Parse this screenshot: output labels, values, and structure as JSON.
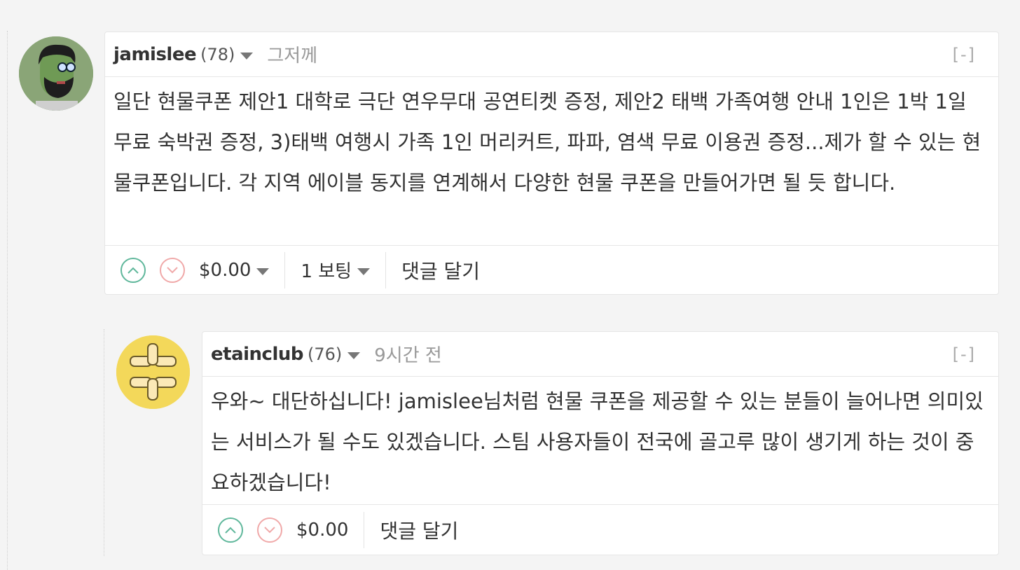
{
  "comments": [
    {
      "author": "jamislee",
      "reputation": "(78)",
      "time": "그저께",
      "collapse": "[-]",
      "body": "일단 현물쿠폰 제안1 대학로 극단 연우무대 공연티켓 증정, 제안2 태백 가족여행 안내 1인은 1박 1일 무료 숙박권 증정, 3)태백 여행시 가족 1인 머리커트, 파파, 염색 무료 이용권 증정...제가 할 수 있는 현물쿠폰입니다. 각 지역 에이블 동지를 연계해서 다양한 현물 쿠폰을 만들어가면 될 듯 합니다.",
      "payout": "$0.00",
      "votes": "1 보팅",
      "reply": "댓글 달기"
    },
    {
      "author": "etainclub",
      "reputation": "(76)",
      "time": "9시간 전",
      "collapse": "[-]",
      "body": "우와~ 대단하십니다! jamislee님처럼 현물 쿠폰을 제공할 수 있는 분들이 늘어나면 의미있는 서비스가 될 수도 있겠습니다. 스팀 사용자들이 전국에 골고루 많이 생기게 하는 것이 중요하겠습니다!",
      "payout": "$0.00",
      "reply": "댓글 달기"
    }
  ],
  "icons": {
    "upvote": "chevron-up-icon",
    "downvote": "chevron-down-icon",
    "accent_up": "#5fb79b",
    "accent_down": "#f0a9a9"
  }
}
